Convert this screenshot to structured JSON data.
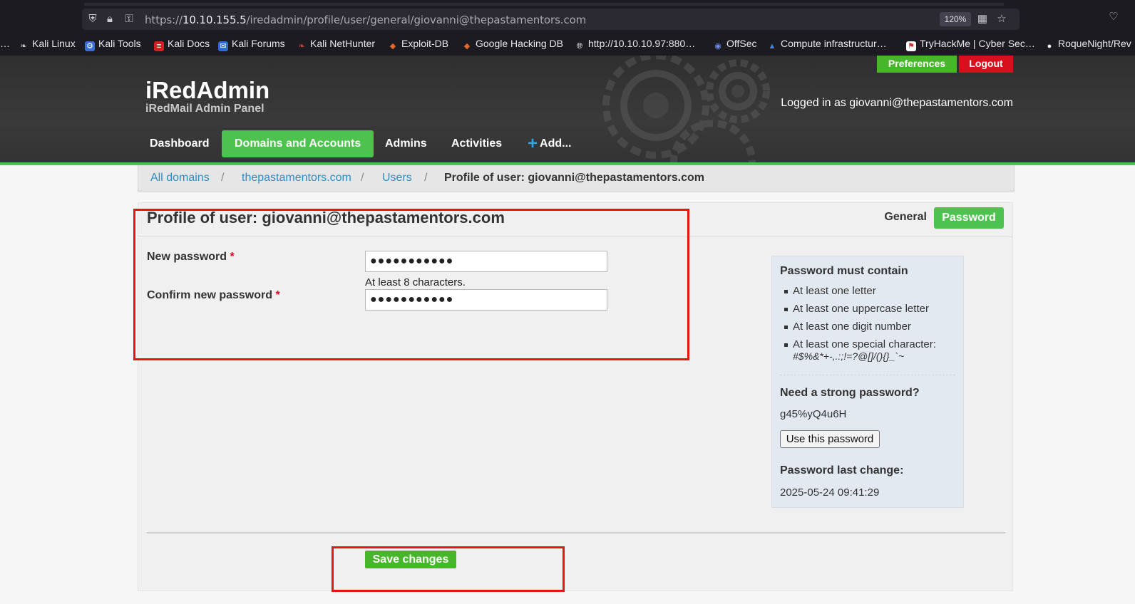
{
  "browser": {
    "url_prefix": "https://",
    "url_host": "10.10.155.5",
    "url_path": "/iredadmin/profile/user/general/giovanni@thepastamentors.com",
    "zoom": "120%",
    "bookmarks": [
      "…",
      "Kali Linux",
      "Kali Tools",
      "Kali Docs",
      "Kali Forums",
      "Kali NetHunter",
      "Exploit-DB",
      "Google Hacking DB",
      "http://10.10.10.97:880…",
      "OffSec",
      "Compute infrastructur…",
      "TryHackMe | Cyber Sec…",
      "RoqueNight/Rev"
    ]
  },
  "header": {
    "brand": "iRedAdmin",
    "subtitle": "iRedMail Admin Panel",
    "preferences": "Preferences",
    "logout": "Logout",
    "logged_in": "Logged in as giovanni@thepastamentors.com",
    "nav": [
      "Dashboard",
      "Domains and Accounts",
      "Admins",
      "Activities",
      "Add..."
    ]
  },
  "breadcrumb": {
    "all_domains": "All domains",
    "domain": "thepastamentors.com",
    "users": "Users",
    "current": "Profile of user: giovanni@thepastamentors.com",
    "sep": "/"
  },
  "profile": {
    "title": "Profile of user: giovanni@thepastamentors.com",
    "tab_general": "General",
    "tab_password": "Password",
    "new_password_label": "New password",
    "confirm_password_label": "Confirm new password",
    "required_mark": "*",
    "new_password_value": "●●●●●●●●●●●",
    "confirm_password_value": "●●●●●●●●●●●",
    "hint": "At least 8 characters.",
    "save": "Save changes"
  },
  "rules": {
    "heading": "Password must contain",
    "items": [
      "At least one letter",
      "At least one uppercase letter",
      "At least one digit number",
      "At least one special character:"
    ],
    "special_chars": "#$%&*+-,.:;!=?@[]/(){}_`~",
    "strong_heading": "Need a strong password?",
    "suggested": "g45%yQ4u6H",
    "use_button": "Use this password",
    "last_change_heading": "Password last change:",
    "last_change_value": "2025-05-24 09:41:29"
  }
}
